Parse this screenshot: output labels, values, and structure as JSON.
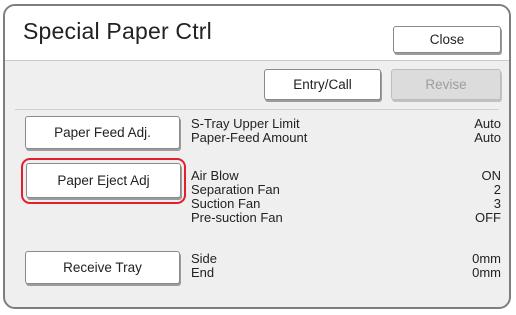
{
  "header": {
    "title": "Special Paper Ctrl",
    "close_label": "Close"
  },
  "toolbar": {
    "entry_call_label": "Entry/Call",
    "revise_label": "Revise"
  },
  "sections": [
    {
      "button_label": "Paper Feed Adj.",
      "rows": [
        {
          "label": "S-Tray Upper Limit",
          "value": "Auto"
        },
        {
          "label": "Paper-Feed Amount",
          "value": "Auto"
        }
      ]
    },
    {
      "button_label": "Paper Eject Adj",
      "rows": [
        {
          "label": "Air Blow",
          "value": "ON"
        },
        {
          "label": "Separation Fan",
          "value": "2"
        },
        {
          "label": "Suction Fan",
          "value": "3"
        },
        {
          "label": "Pre-suction Fan",
          "value": "OFF"
        }
      ]
    },
    {
      "button_label": "Receive Tray",
      "rows": [
        {
          "label": "Side",
          "value": "0mm"
        },
        {
          "label": "End",
          "value": "0mm"
        }
      ]
    }
  ],
  "colors": {
    "highlight": "#e0202a",
    "panel_bg": "#efefef",
    "disabled_bg": "#dcdcdc"
  }
}
